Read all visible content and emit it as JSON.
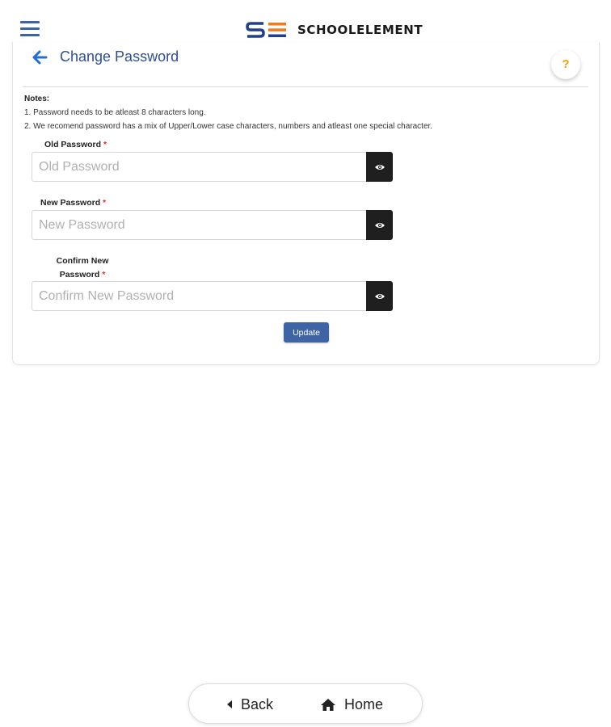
{
  "header": {
    "brand": "SCHOOLELEMENT",
    "logo_colors": {
      "s": "#1f3f8f",
      "e": "#f07a1a"
    }
  },
  "page": {
    "title": "Change Password",
    "help_label": "?"
  },
  "notes": {
    "title": "Notes:",
    "items": [
      "1. Password needs to be atleast 8 characters long.",
      "2. We recomend password has a mix of Upper/Lower case characters, numbers and atleast one special character."
    ]
  },
  "form": {
    "old_password": {
      "label": "Old Password",
      "required_mark": "*",
      "placeholder": "Old Password",
      "value": ""
    },
    "new_password": {
      "label": "New Password",
      "required_mark": "*",
      "placeholder": "New Password",
      "value": ""
    },
    "confirm_password": {
      "label_line1": "Confirm New",
      "label_line2": "Password",
      "required_mark": "*",
      "placeholder": "Confirm New Password",
      "value": ""
    },
    "submit_label": "Update"
  },
  "bottom_nav": {
    "back_label": "Back",
    "home_label": "Home"
  },
  "colors": {
    "accent": "#3f64a6",
    "title": "#2f4f8f",
    "help": "#f0a000",
    "required": "#d9322e",
    "eye_button": "#1f1f1f"
  },
  "icons": [
    "hamburger-menu-icon",
    "arrow-left-icon",
    "question-icon",
    "eye-icon",
    "caret-left-icon",
    "home-icon"
  ]
}
